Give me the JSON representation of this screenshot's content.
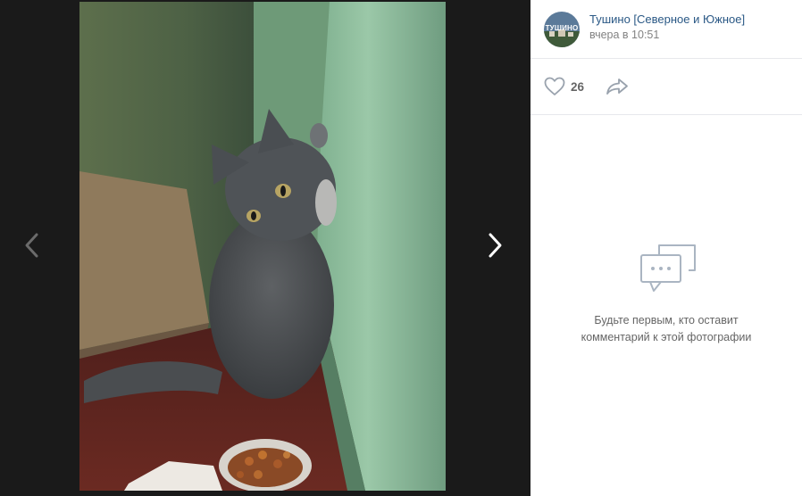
{
  "post": {
    "owner_name": "Тушино [Северное и Южное]",
    "date": "вчера в 10:51",
    "avatar_text": "ТУШИНО"
  },
  "actions": {
    "like_count": "26",
    "like_icon": "heart-icon",
    "share_icon": "share-arrow-icon"
  },
  "comments": {
    "empty_line1": "Будьте первым, кто оставит",
    "empty_line2": "комментарий к этой фотографии"
  },
  "navigation": {
    "prev_icon": "chevron-left-icon",
    "next_icon": "chevron-right-icon"
  },
  "colors": {
    "link": "#2a5885",
    "muted": "#828282",
    "background_dark": "#1a1a1a"
  }
}
